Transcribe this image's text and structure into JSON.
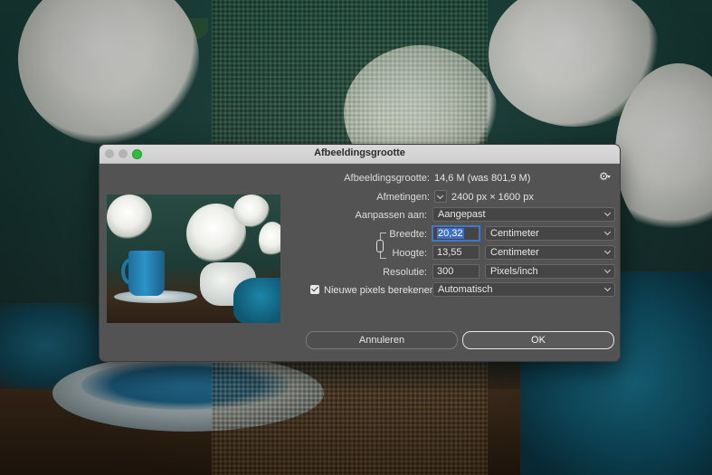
{
  "dialog": {
    "title": "Afbeeldingsgrootte"
  },
  "info": {
    "size_label": "Afbeeldingsgrootte:",
    "size_value": "14,6 M (was 801,9 M)",
    "dimensions_label": "Afmetingen:",
    "dimensions_value": "2400 px  ×  1600 px"
  },
  "fit": {
    "label": "Aanpassen aan:",
    "value": "Aangepast"
  },
  "width": {
    "label": "Breedte:",
    "value": "20,32",
    "unit": "Centimeter"
  },
  "height": {
    "label": "Hoogte:",
    "value": "13,55",
    "unit": "Centimeter"
  },
  "resolution": {
    "label": "Resolutie:",
    "value": "300",
    "unit": "Pixels/inch"
  },
  "resample": {
    "label": "Nieuwe pixels berekenen:",
    "checked": true,
    "value": "Automatisch"
  },
  "buttons": {
    "cancel": "Annuleren",
    "ok": "OK"
  },
  "colors": {
    "dialog_bg": "#535353",
    "accent": "#3d6fc2",
    "traffic_zoom": "#2fbd3f"
  }
}
